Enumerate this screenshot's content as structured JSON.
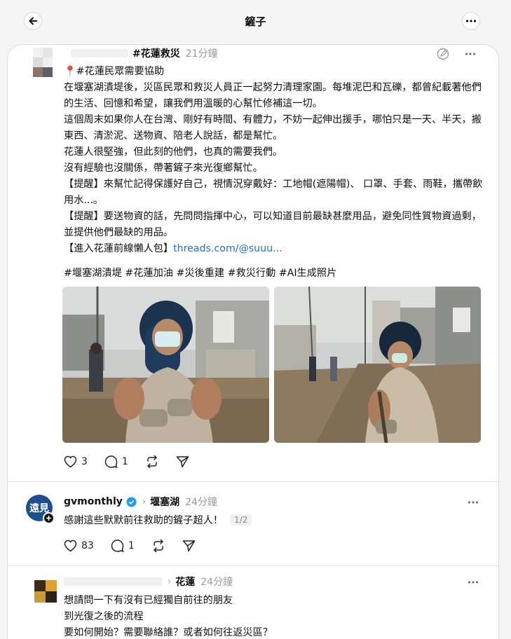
{
  "header": {
    "title": "鏟子"
  },
  "post1": {
    "author": "#花蓮救災",
    "time": "21分鐘",
    "lines": [
      "📍#花蓮民眾需要協助",
      "在堰塞湖潰堤後，災區民眾和救災人員正一起努力清理家園。每堆泥巴和瓦礫，都曾紀載著他們的生活、回憶和希望，讓我們用溫暖的心幫忙修補這一切。",
      "這個周末如果你人在台灣、剛好有時間、有體力，不妨一起伸出援手，哪怕只是一天、半天，搬東西、清淤泥、送物資、陪老人說話，都是幫忙。",
      "花蓮人很堅強，但此刻的他們，也真的需要我們。",
      "沒有經驗也沒關係，帶著鏟子來光復鄉幫忙。",
      "【提醒】來幫忙記得保護好自己，視情況穿戴好：工地帽(遮陽帽)、 口罩、手套、雨鞋，攜帶飲用水...。",
      "【提醒】要送物資的話，先問問指揮中心，可以知道目前最缺甚麼用品，避免同性質物資過剩，並提供他們最缺的用品。"
    ],
    "guide_prefix": "【進入花蓮前線懶人包】",
    "guide_link": "threads.com/@suuu...",
    "tags": "#堰塞湖潰堤 #花蓮加油 #災後重建 #救災行動 #AI生成照片",
    "likes": "3",
    "comments": "1"
  },
  "post2": {
    "author": "gvmonthly",
    "avatar_text": "遠見",
    "topic": "堰塞湖",
    "time": "24分鐘",
    "text": "感謝這些默默前往救助的鏟子超人！",
    "page": "1/2",
    "likes": "83",
    "comments": "1"
  },
  "post3": {
    "topic": "花蓮",
    "time": "24分鐘",
    "lines": [
      "想請問一下有沒有已經獨自前往的朋友",
      "到光復之後的流程",
      "要如何開始？需要聯絡誰？或者如何往返災區？"
    ]
  },
  "icons": {
    "back": "back-arrow-icon",
    "more": "more-icon",
    "heart": "heart-icon",
    "comment": "comment-icon",
    "repost": "repost-icon",
    "share": "send-icon",
    "edit": "edit-icon",
    "verified": "verified-icon",
    "follow": "follow-plus-icon"
  },
  "colors": {
    "link": "#2a6fc4",
    "verified": "#1d9bf0",
    "avatar_bg": "#1f4e8c"
  }
}
